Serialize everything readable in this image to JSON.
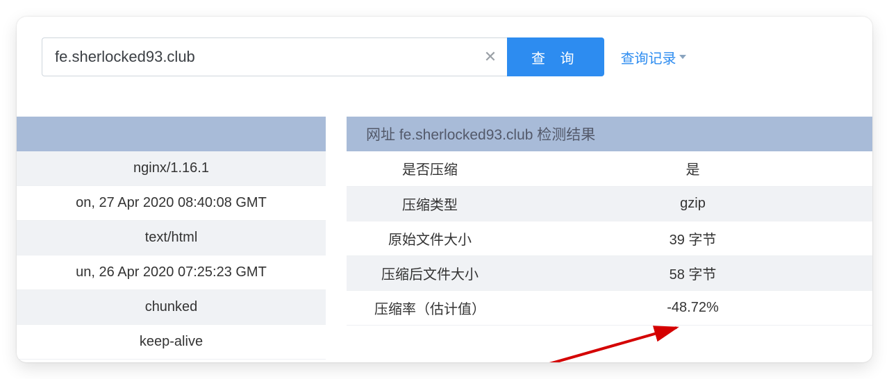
{
  "search": {
    "value": "fe.sherlocked93.club",
    "placeholder": "",
    "buttonLabel": "查 询",
    "historyLabel": "查询记录"
  },
  "leftHeaders": {
    "rows": [
      "nginx/1.16.1",
      "on, 27 Apr 2020 08:40:08 GMT",
      "text/html",
      "un, 26 Apr 2020 07:25:23 GMT",
      "chunked",
      "keep-alive"
    ]
  },
  "result": {
    "title": "网址 fe.sherlocked93.club 检测结果",
    "rows": [
      {
        "label": "是否压缩",
        "value": "是",
        "highlight": true
      },
      {
        "label": "压缩类型",
        "value": "gzip",
        "highlight": false
      },
      {
        "label": "原始文件大小",
        "value": "39 字节",
        "highlight": false
      },
      {
        "label": "压缩后文件大小",
        "value": "58 字节",
        "highlight": false
      },
      {
        "label": "压缩率（估计值）",
        "value": "-48.72%",
        "highlight": false
      }
    ]
  }
}
